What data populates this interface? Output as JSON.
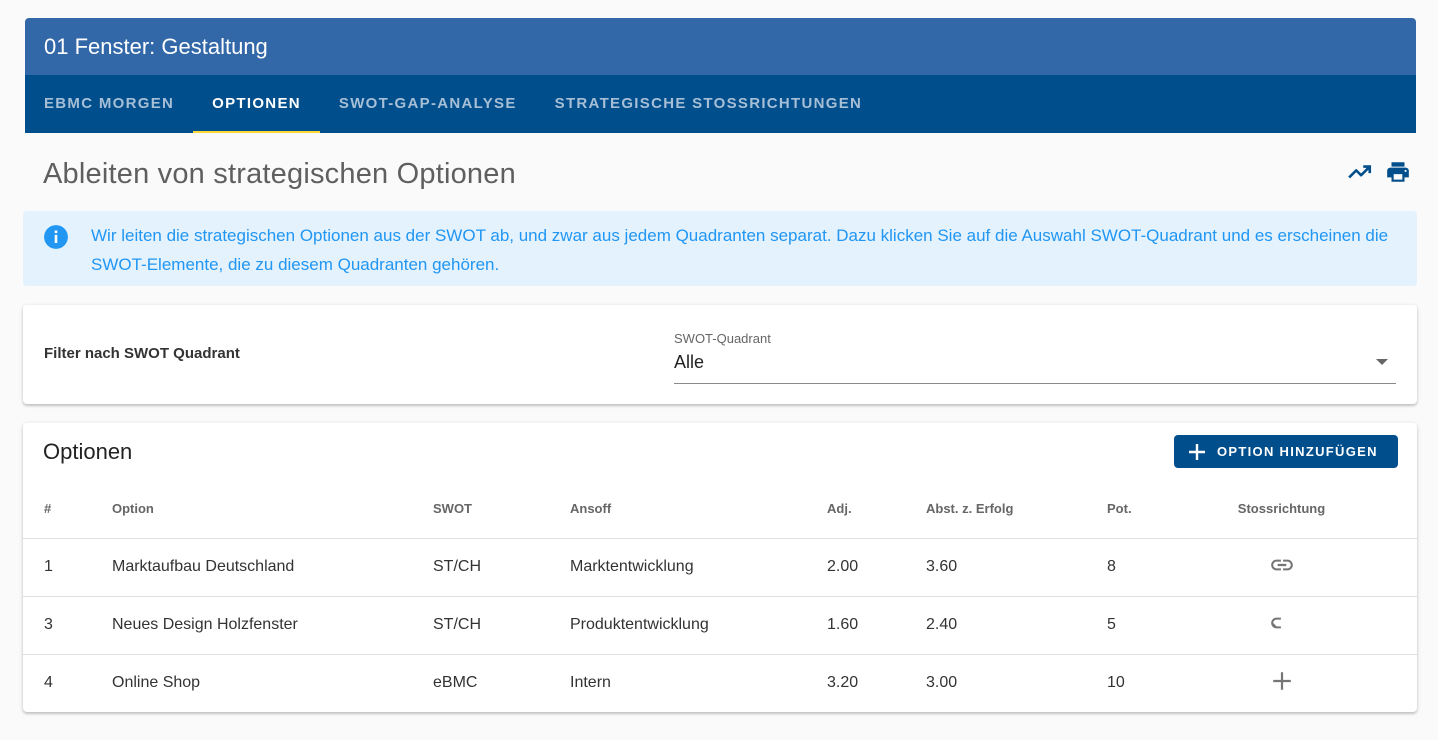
{
  "header": {
    "title": "01 Fenster: Gestaltung",
    "tabs": [
      {
        "label": "EBMC MORGEN",
        "active": false
      },
      {
        "label": "OPTIONEN",
        "active": true
      },
      {
        "label": "SWOT-GAP-ANALYSE",
        "active": false
      },
      {
        "label": "STRATEGISCHE STOSSRICHTUNGEN",
        "active": false
      }
    ]
  },
  "page": {
    "title": "Ableiten von strategischen Optionen",
    "icons": [
      "trending-icon",
      "print-icon"
    ]
  },
  "info": {
    "text": "Wir leiten die strategischen Optionen aus der SWOT ab, und zwar aus jedem Quadranten separat. Dazu klicken Sie auf die Auswahl SWOT-Quadrant und es erscheinen die SWOT-Elemente, die zu diesem Quadranten gehören."
  },
  "filter": {
    "label": "Filter nach SWOT Quadrant",
    "select_label": "SWOT-Quadrant",
    "select_value": "Alle"
  },
  "options": {
    "title": "Optionen",
    "add_button": "OPTION HINZUFÜGEN",
    "columns": [
      "#",
      "Option",
      "SWOT",
      "Ansoff",
      "Adj.",
      "Abst. z. Erfolg",
      "Pot.",
      "Stossrichtung"
    ],
    "rows": [
      {
        "num": "1",
        "option": "Marktaufbau Deutschland",
        "swot": "ST/CH",
        "ansoff": "Marktentwicklung",
        "adj": "2.00",
        "abst": "3.60",
        "pot": "8",
        "action_icon": "link-icon"
      },
      {
        "num": "3",
        "option": "Neues Design Holzfenster",
        "swot": "ST/CH",
        "ansoff": "Produktentwicklung",
        "adj": "1.60",
        "abst": "2.40",
        "pot": "5",
        "action_icon": "link-icon"
      },
      {
        "num": "4",
        "option": "Online Shop",
        "swot": "eBMC",
        "ansoff": "Intern",
        "adj": "3.20",
        "abst": "3.00",
        "pot": "10",
        "action_icon": "plus-icon"
      }
    ]
  },
  "colors": {
    "title_bar": "#3267a8",
    "tab_bar": "#004e8c",
    "tab_indicator": "#fdd835",
    "info_bg": "#e3f2fd",
    "info_text": "#2196f3"
  }
}
